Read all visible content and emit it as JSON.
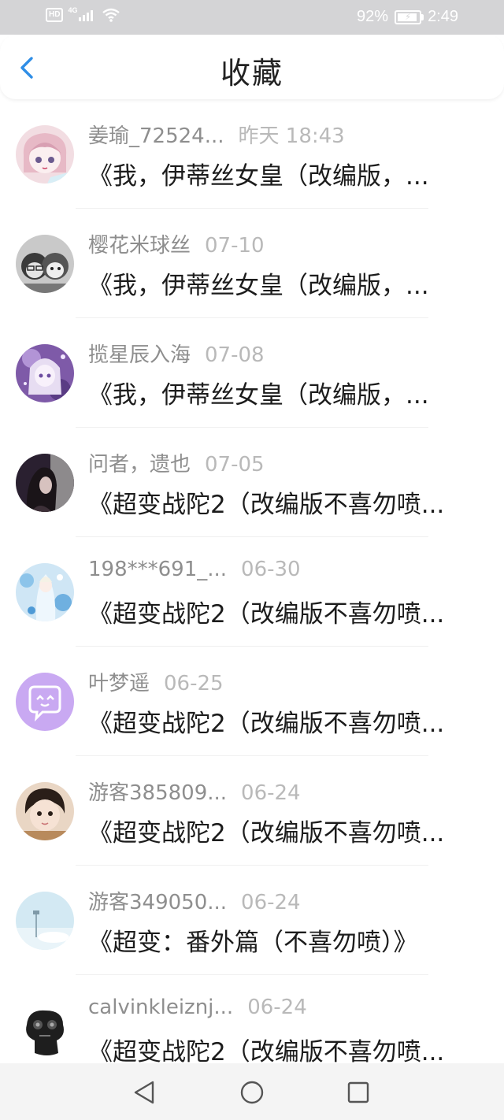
{
  "status_bar": {
    "hd": "HD",
    "network": "4G",
    "battery": "92%",
    "time": "2:49"
  },
  "header": {
    "title": "收藏",
    "back_icon": "chevron-left-icon",
    "accent": "#2f8ee6"
  },
  "items": [
    {
      "name": "姜瑜_72524...",
      "time": "昨天 18:43",
      "title": "《我，伊蒂丝女皇（改编版，...",
      "avatar": "avatar-anime-girl-pink"
    },
    {
      "name": "樱花米球丝",
      "time": "07-10",
      "title": "《我，伊蒂丝女皇（改编版，...",
      "avatar": "avatar-anime-pair-gray"
    },
    {
      "name": "揽星辰入海",
      "time": "07-08",
      "title": "《我，伊蒂丝女皇（改编版，...",
      "avatar": "avatar-anime-girl-purple"
    },
    {
      "name": "问者，遗也",
      "time": "07-05",
      "title": "《超变战陀2（改编版不喜勿喷...",
      "avatar": "avatar-dark-portrait"
    },
    {
      "name": "198***691_...",
      "time": "06-30",
      "title": "《超变战陀2（改编版不喜勿喷...",
      "avatar": "avatar-ice-princess"
    },
    {
      "name": "叶梦遥",
      "time": "06-25",
      "title": "《超变战陀2（改编版不喜勿喷...",
      "avatar": "avatar-chat-bubble"
    },
    {
      "name": "游客385809...",
      "time": "06-24",
      "title": "《超变战陀2（改编版不喜勿喷...",
      "avatar": "avatar-child-photo"
    },
    {
      "name": "游客349050...",
      "time": "06-24",
      "title": "《超变：番外篇（不喜勿喷）》",
      "avatar": "avatar-sky"
    },
    {
      "name": "calvinkleiznj...",
      "time": "06-24",
      "title": "《超变战陀2（改编版不喜勿喷...",
      "avatar": "avatar-black-object"
    }
  ],
  "nav_bar": {
    "back_icon": "triangle-back-icon",
    "home_icon": "circle-home-icon",
    "recents_icon": "square-recents-icon"
  }
}
